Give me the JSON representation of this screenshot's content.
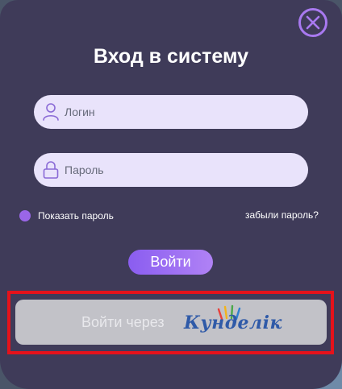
{
  "modal": {
    "title": "Вход в систему"
  },
  "login_field": {
    "placeholder": "Логин",
    "value": ""
  },
  "password_field": {
    "placeholder": "Пароль",
    "value": ""
  },
  "show_password_label": "Показать пароль",
  "forgot_password_label": "забыли пароль?",
  "login_button_label": "Войти",
  "sso_button": {
    "label": "Войти через",
    "logo_text": "Кунделік"
  },
  "colors": {
    "modal_bg": "#3f3b59",
    "accent": "#9a66e8",
    "input_bg": "#e9e3fb",
    "highlight": "#e5121b",
    "logo_blue": "#2f5aa8"
  },
  "icons": {
    "close": "close-icon",
    "user": "user-icon",
    "lock": "lock-icon"
  }
}
